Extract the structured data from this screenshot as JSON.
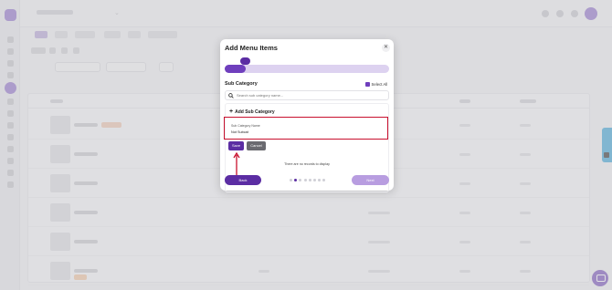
{
  "modal": {
    "title": "Add Menu Items",
    "close_icon": "close-icon",
    "progress_step": 1,
    "progress_steps_total": 8,
    "progress_fraction": 0.13,
    "section_title": "Sub Category",
    "select_all_label": "Select All",
    "select_all_checked": true,
    "search": {
      "placeholder": "Search sub category name...",
      "value": ""
    },
    "add_subcategory_label": "Add Sub Category",
    "form": {
      "field_label": "Sub Category Name",
      "field_value": "Not Subcat",
      "save_label": "Save",
      "cancel_label": "Cancel"
    },
    "empty_message": "There are no records to display",
    "back_label": "Back",
    "next_label": "Next"
  },
  "colors": {
    "primary": "#5b2da3",
    "highlight": "#c8102e",
    "feedback": "#2a9fd8"
  }
}
